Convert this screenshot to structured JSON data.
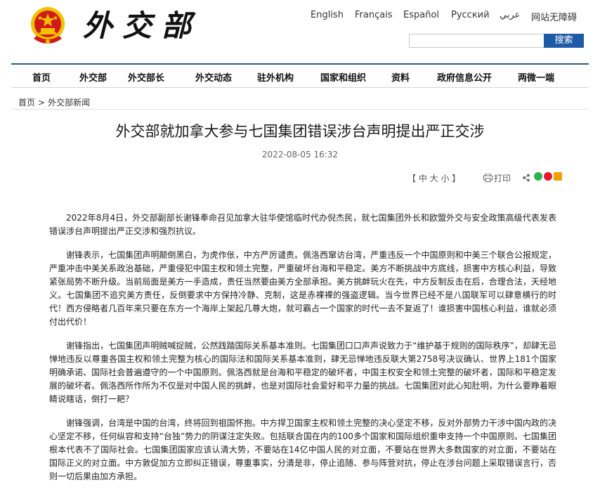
{
  "header": {
    "site_logo_text": "外交部",
    "languages": [
      "English",
      "Français",
      "Español",
      "Русский",
      "عربي",
      "网站无障碍"
    ],
    "search": {
      "placeholder": "",
      "button_label": "搜索"
    }
  },
  "nav": {
    "items": [
      "首页",
      "外交部",
      "外交部长",
      "外交动态",
      "驻外机构",
      "国家和组织",
      "资料",
      "政府信息公开",
      "两微一端"
    ]
  },
  "breadcrumb": {
    "home": "首页",
    "separator": ">",
    "current": "外交部新闻"
  },
  "article": {
    "title": "外交部就加拿大参与七国集团错误涉台声明提出严正交涉",
    "date": "2022-08-05 16:32",
    "font_size_label": "【 中  大  小 】",
    "print_label": "打印",
    "paragraphs": [
      "2022年8月4日，外交部副部长谢锋奉命召见加拿大驻华使馆临时代办倪杰民，就七国集团外长和欧盟外交与安全政策高级代表发表错误涉台声明提出严正交涉和强烈抗议。",
      "谢锋表示，七国集团声明颠倒黑白，为虎作伥，中方严厉谴责。佩洛西窜访台湾，严重违反一个中国原则和中美三个联合公报规定，严重冲击中美关系政治基础，严重侵犯中国主权和领土完整，严重破坏台海和平稳定。美方不断挑战中方底线，损害中方核心利益，导致紧张局势不断升级。当前局面是美方一手造成，责任当然要由美方全部承担。美方挑衅玩火在先，中方反制反击在后，合理合法，天经地义。七国集团不追究美方责任，反倒要求中方保持冷静、克制，这是赤裸裸的强盗逻辑。当今世界已经不是八国联军可以肆意横行的时代！西方侵略者几百年来只要在东方一个海岸上架起几尊大炮，就可霸占一个国家的时代一去不复返了！谁损害中国核心利益，谁就必须付出代价！",
      "谢锋指出，七国集团声明贼喊捉贼，公然践踏国际关系基本准则。七国集团口口声声说致力于“维护基于规则的国际秩序”，却肆无忌惮地违反以尊重各国主权和领土完整为核心的国际法和国际关系基本准则，肆无忌惮地违反联大第2758号决议确认、世界上181个国家明确承诺、国际社会普遍遵守的一个中国原则。佩洛西就是台海和平稳定的破坏者，中国主权安全和领土完整的破坏者，国际和平稳定发展的破坏者。佩洛西所作所为不仅是对中国人民的挑衅，也是对国际社会爱好和平力量的挑战。七国集团对此心知肚明，为什么要睁着眼睛说瞎话，倒打一耙？",
      "谢锋强调，台湾是中国的台湾，终将回到祖国怀抱。中方捍卫国家主权和领土完整的决心坚定不移，反对外部势力干涉中国内政的决心坚定不移，任何纵容和支持“台独”势力的阴谋注定失败。包括联合国在内的100多个国家和国际组织重申支持一个中国原则。七国集团根本代表不了国际社会。七国集团国家应该认清大势，不要站在14亿中国人民的对立面，不要站在世界大多数国家的对立面，不要站在国际正义的对立面。中方敦促加方立即纠正错误，尊重事实，分清是非，停止追随、参与阵营对抗，停止在涉台问题上采取错误言行，否则一切后果由加方承担。"
    ]
  },
  "colors": {
    "nav_border": "#2a5a9c",
    "search_button": "#1f5aa6",
    "emblem_red": "#d21a1a",
    "emblem_gold": "#f2c200"
  }
}
